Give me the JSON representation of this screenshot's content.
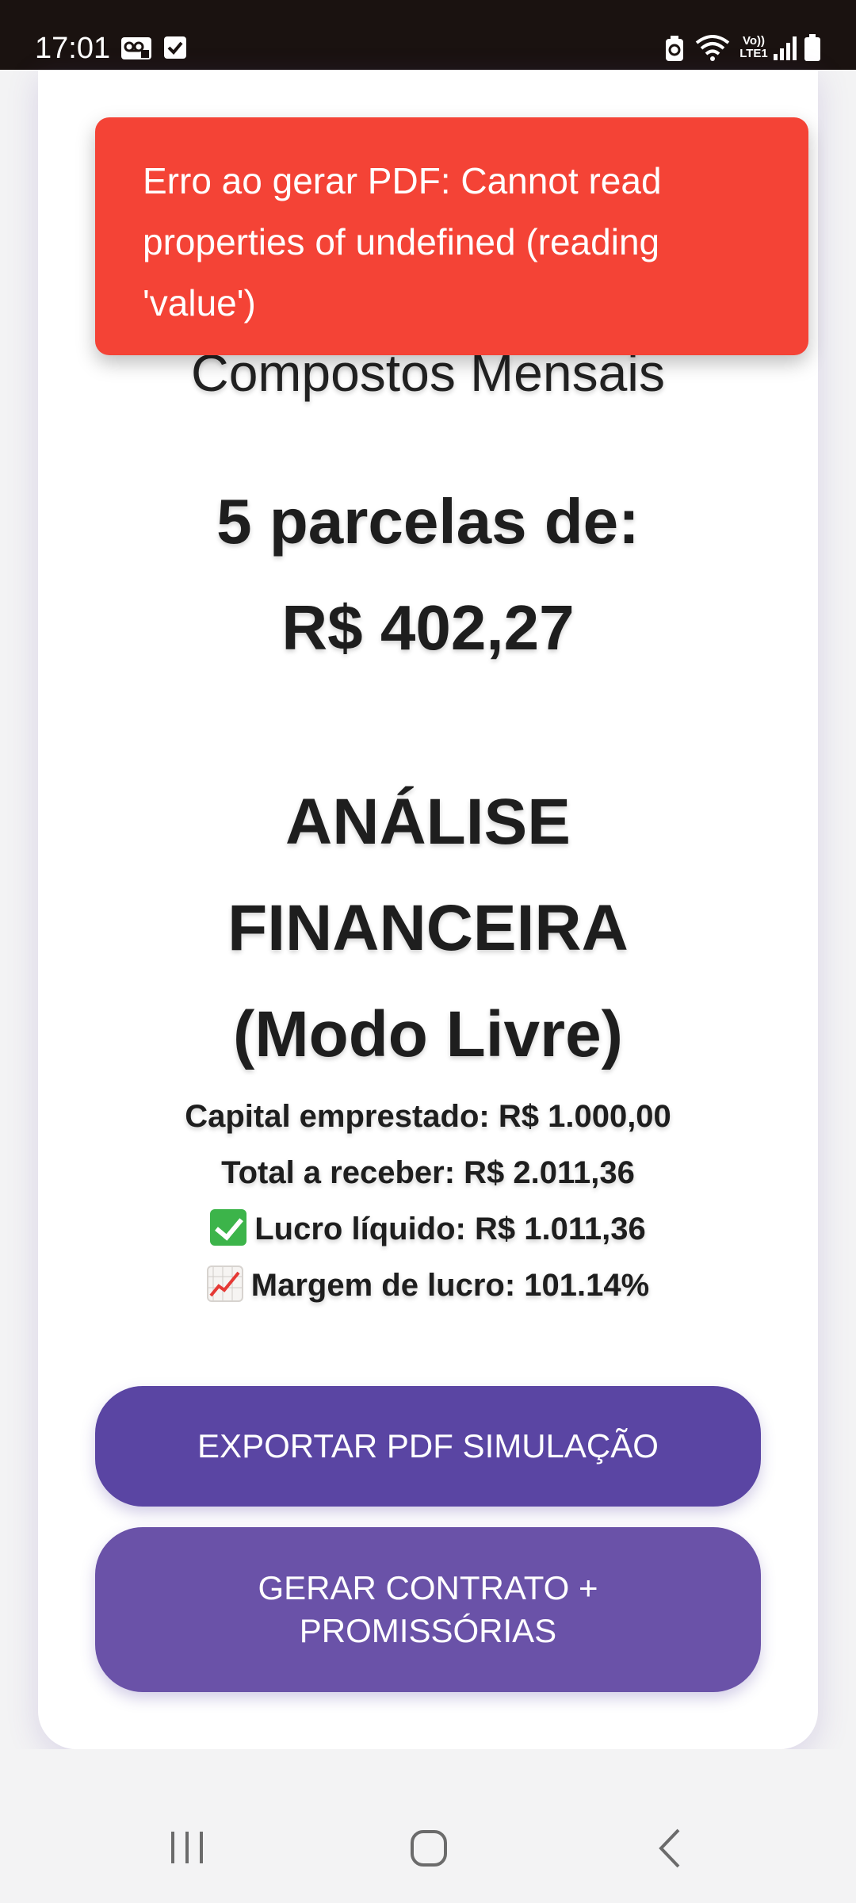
{
  "status_bar": {
    "time": "17:01",
    "left_icons": [
      "voicemail-icon",
      "checkbox-icon"
    ],
    "right_icons": [
      "battery-saver-icon",
      "wifi-icon",
      "volte-lte-icon",
      "signal-icon",
      "battery-icon"
    ],
    "volte_label": "Vo))",
    "lte_label": "LTE1"
  },
  "toast": {
    "message": "Erro ao gerar PDF: Cannot read properties of undefined (reading 'value')",
    "color": "#f44336"
  },
  "result": {
    "subtitle": "Compostos Mensais",
    "installments_label": "5 parcelas de:",
    "installment_value": "R$ 402,27"
  },
  "analysis": {
    "title_lines": [
      "ANÁLISE",
      "FINANCEIRA",
      "(Modo Livre)"
    ],
    "capital": "Capital emprestado: R$ 1.000,00",
    "total": "Total a receber: R$ 2.011,36",
    "profit": "Lucro líquido: R$ 1.011,36",
    "margin": "Margem de lucro: 101.14%",
    "profit_icon": "check-mark-icon",
    "margin_icon": "chart-increasing-icon"
  },
  "buttons": {
    "export_pdf": "EXPORTAR PDF SIMULAÇÃO",
    "contract_line1": "GERAR CONTRATO +",
    "contract_line2": "PROMISSÓRIAS"
  },
  "colors": {
    "primary_button": "#5a45a3",
    "secondary_button": "#6a52a8",
    "status_bar": "#1a1210"
  },
  "nav_bar": {
    "icons": [
      "recent-apps-icon",
      "home-icon",
      "back-icon"
    ]
  }
}
